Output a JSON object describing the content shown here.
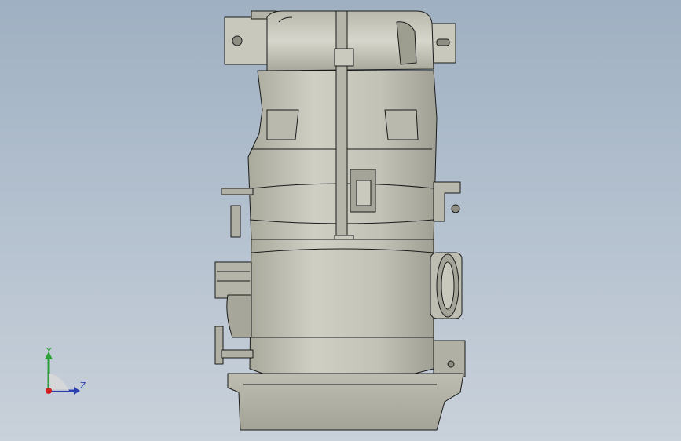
{
  "viewport": {
    "background_top": "#9fb0c2",
    "background_bottom": "#c9d1da"
  },
  "model": {
    "fill_color": "#c4c4b8",
    "shade_color": "#9d9d90",
    "edge_color": "#1a1a1a"
  },
  "triad": {
    "y_label": "Y",
    "z_label": "Z",
    "y_color": "#2e9e3a",
    "z_color": "#2a3fb0",
    "origin_color": "#d02020"
  }
}
